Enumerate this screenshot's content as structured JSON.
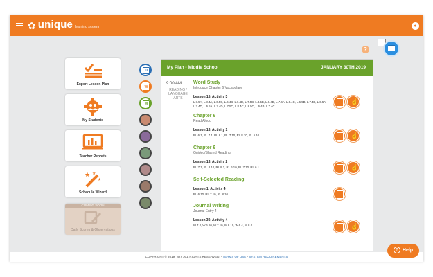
{
  "app": {
    "logo_text": "unique",
    "logo_sub": "learning system"
  },
  "tools": [
    {
      "label": "Export Lesson Plan",
      "icon": "checklist-icon"
    },
    {
      "label": "My Students",
      "icon": "gear-people-icon"
    },
    {
      "label": "Teacher Reports",
      "icon": "report-chart-icon"
    },
    {
      "label": "Schedule Wizard",
      "icon": "magic-wand-icon"
    },
    {
      "label": "Daily Scores & Observations",
      "banner": "COMING SOON",
      "icon": "scores-icon"
    }
  ],
  "rail": [
    {
      "type": "calendar",
      "letter": "D",
      "color": "#2b6fb5"
    },
    {
      "type": "calendar",
      "letter": "W",
      "color": "#ef7b22"
    },
    {
      "type": "calendar",
      "letter": "M",
      "color": "#6aa22b"
    }
  ],
  "plan": {
    "title": "My Plan - Middle School",
    "date": "JANUARY 30TH 2019",
    "time": "9:00 AM",
    "subject": "READING / LANGUAGE ARTS",
    "activities": [
      {
        "name": "Word Study",
        "sub": "Introduce Chapter 6 Vocabulary",
        "lesson": "Lesson 15, Activity 3",
        "standards": "L.7.5A, L.8.4A, L.6.5C, L.6.4B, L.6.4D, L.7.5B, L.8.5B, L.6.4D, L.7.4A, L.6.4C, L.6.5B, L.7.4B, L.6.5A, L.7.4D, L.6.5A, L.7.4D, L.7.5C, L.8.4C, L.8.5C, L.6.4B, L.7.4C",
        "buttons": 2
      },
      {
        "name": "Chapter 6",
        "sub": "Read Aloud",
        "lesson": "Lesson 13, Activity 1",
        "standards": "RL.6.1, RL.7.1, RL.8.1, RL.7.10, RL.8.10, RL.6.10",
        "buttons": 2
      },
      {
        "name": "Chapter 6",
        "sub": "Guided/Shared Reading",
        "lesson": "Lesson 13, Activity 2",
        "standards": "RL.7.1, RL.8.10, RL.8.1, RL.6.10, RL.7.10, RL.6.1",
        "buttons": 2
      },
      {
        "name": "Self-Selected Reading",
        "sub": "",
        "lesson": "Lesson 1, Activity 4",
        "standards": "RL.6.10, RL.7.10, RL.8.10",
        "buttons": 1
      },
      {
        "name": "Journal Writing",
        "sub": "Journal Entry 4",
        "lesson": "Lesson 30, Activity 4",
        "standards": "W.7.4, W.6.10, W.7.10, W.8.10, W.6.4, W.8.4",
        "buttons": 2
      }
    ]
  },
  "footer": {
    "copyright": "COPYRIGHT © 2019, N2Y ALL RIGHTS RESERVED.",
    "terms": "TERMS OF USE",
    "sep": " - ",
    "sysreq": "SYSTEM REQUIREMENTS"
  },
  "help": {
    "label": "Help"
  },
  "colors": {
    "orange": "#ef7b22",
    "green": "#6aa22b",
    "blue": "#2b8fe0"
  }
}
